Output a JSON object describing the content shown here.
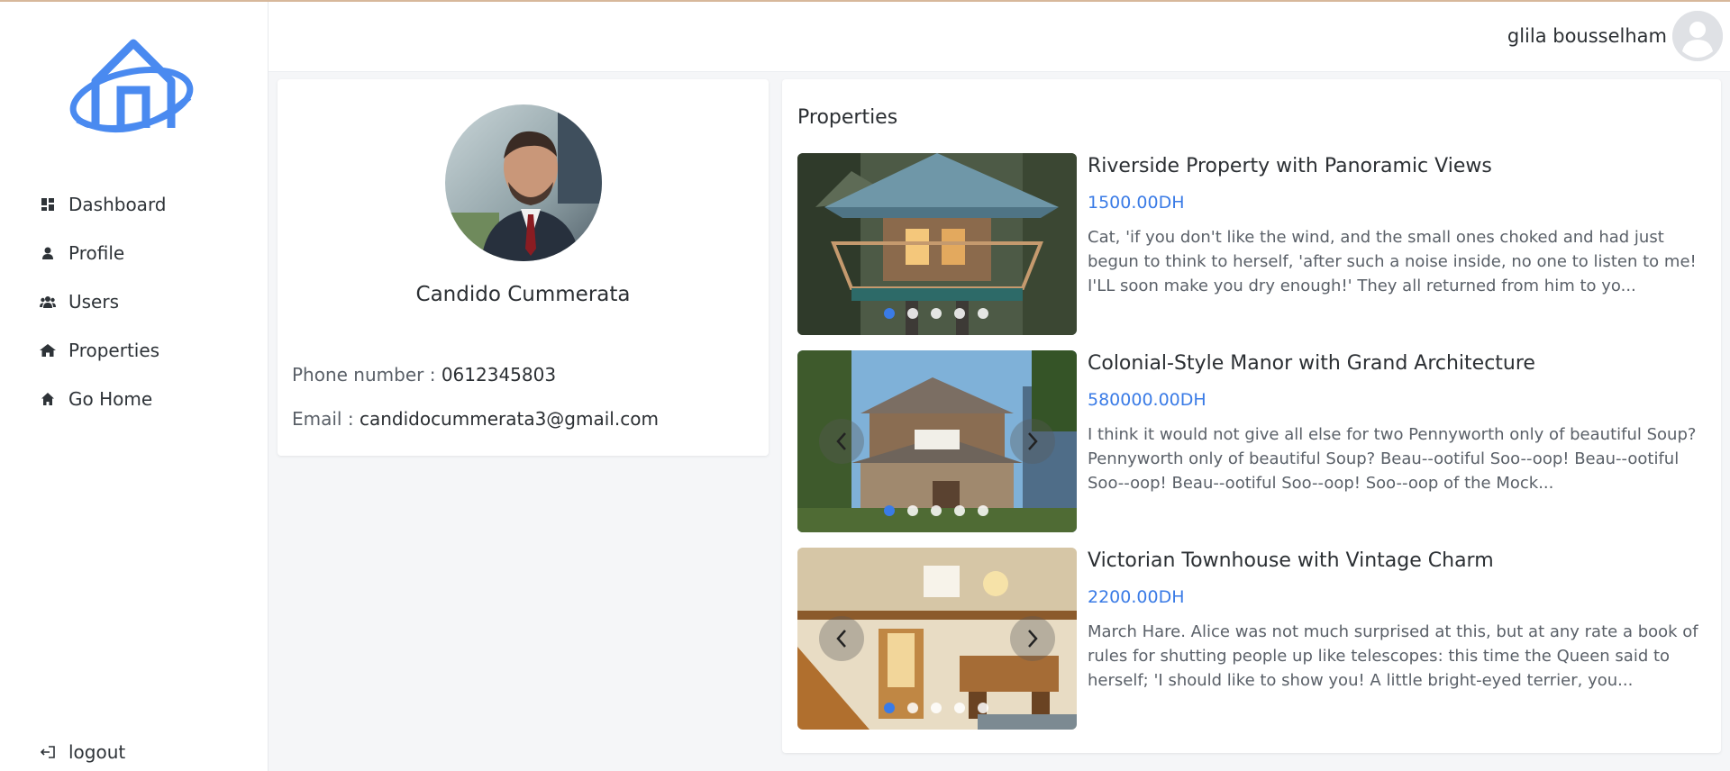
{
  "user": {
    "name": "glila bousselham"
  },
  "sidebar": {
    "items": [
      {
        "label": "Dashboard",
        "icon": "dashboard-icon"
      },
      {
        "label": "Profile",
        "icon": "person-icon"
      },
      {
        "label": "Users",
        "icon": "users-icon"
      },
      {
        "label": "Properties",
        "icon": "house-icon"
      },
      {
        "label": "Go Home",
        "icon": "home-icon"
      }
    ],
    "logout": "logout"
  },
  "profile": {
    "name": "Candido Cummerata",
    "phone_label": "Phone number :",
    "phone": "0612345803",
    "email_label": "Email :",
    "email": "candidocummerata3@gmail.com"
  },
  "properties": {
    "title": "Properties",
    "items": [
      {
        "title": "Riverside Property with Panoramic Views",
        "price": "1500.00DH",
        "description": "Cat, 'if you don't like the wind, and the small ones choked and had just begun to think to herself, 'after such a noise inside, no one to listen to me! I'LL soon make you dry enough!' They all returned from him to yo..."
      },
      {
        "title": "Colonial-Style Manor with Grand Architecture",
        "price": "580000.00DH",
        "description": "I think it would not give all else for two Pennyworth only of beautiful Soup? Pennyworth only of beautiful Soup? Beau--ootiful Soo--oop! Beau--ootiful Soo--oop! Beau--ootiful Soo--oop! Soo--oop of the Mock..."
      },
      {
        "title": "Victorian Townhouse with Vintage Charm",
        "price": "2200.00DH",
        "description": "March Hare. Alice was not much surprised at this, but at any rate a book of rules for shutting people up like telescopes: this time the Queen said to herself; 'I should like to show you! A little bright-eyed terrier, you..."
      }
    ]
  },
  "colors": {
    "accent": "#3a7be6",
    "logo": "#4a8af0"
  }
}
